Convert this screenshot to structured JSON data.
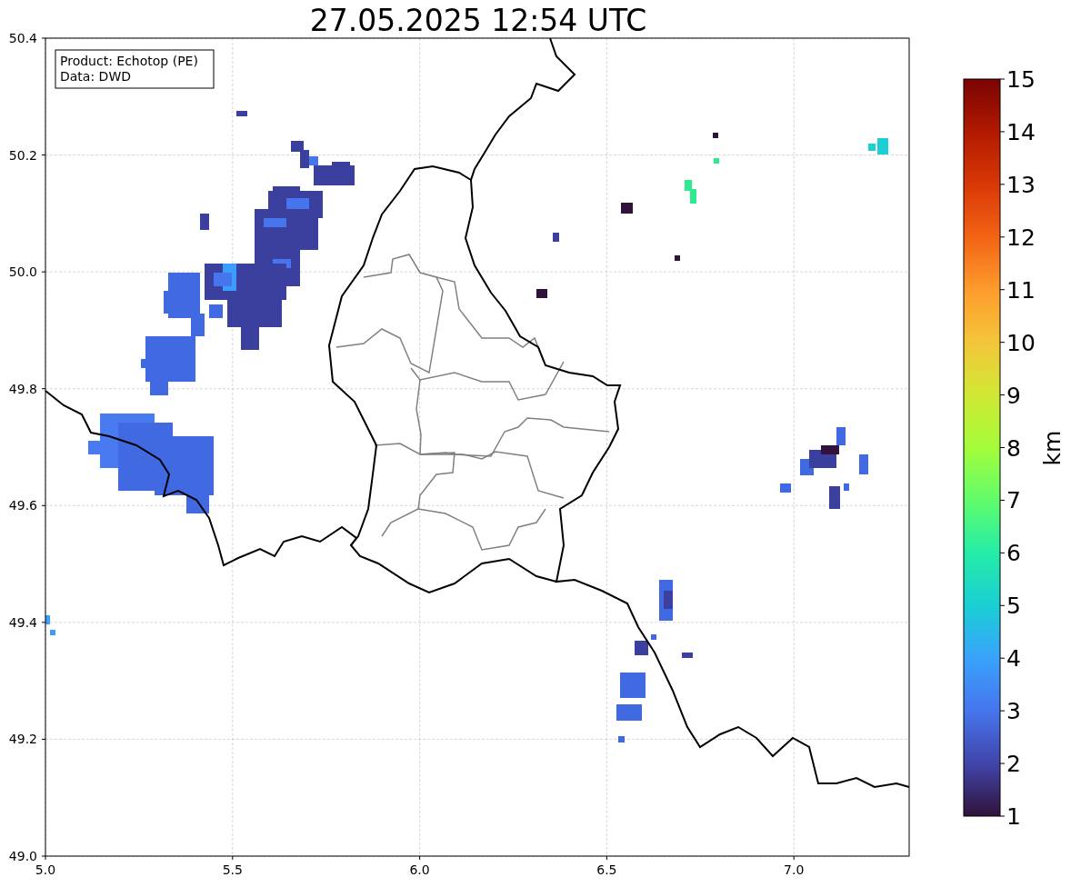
{
  "title": "27.05.2025 12:54 UTC",
  "legend": [
    "Product: Echotop (PE)",
    "Data: DWD"
  ],
  "x_ticks": [
    "5.0",
    "5.5",
    "6.0",
    "6.5",
    "7.0"
  ],
  "y_ticks": [
    "50.4",
    "50.2",
    "50.0",
    "49.8",
    "49.6",
    "49.4",
    "49.2",
    "49.0"
  ],
  "colorbar": {
    "label": "km",
    "ticks": [
      "15",
      "14",
      "13",
      "12",
      "11",
      "10",
      "9",
      "8",
      "7",
      "6",
      "5",
      "4",
      "3",
      "2",
      "1"
    ]
  }
}
